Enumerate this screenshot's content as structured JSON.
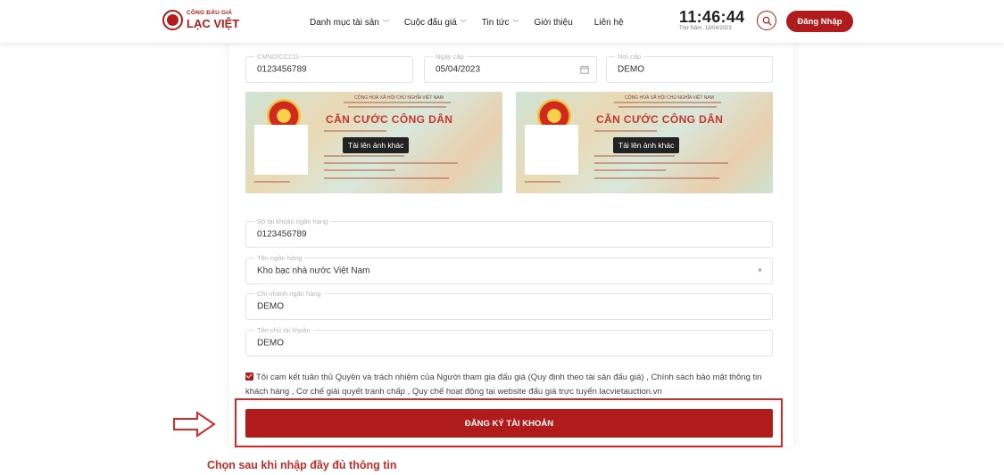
{
  "header": {
    "logo_top": "CÔNG ĐẤU GIÁ",
    "logo_name": "LẠC VIỆT",
    "nav": [
      "Danh mục tài sản",
      "Cuộc đấu giá",
      "Tin tức",
      "Giới thiệu",
      "Liên hệ"
    ],
    "time": "11:46:44",
    "date": "Thứ Năm, 13/04/2023",
    "login_label": "Đăng Nhập"
  },
  "form": {
    "id_number": {
      "label": "CMND/CCCD",
      "value": "0123456789"
    },
    "issue_date": {
      "label": "Ngày cấp",
      "value": "05/04/2023"
    },
    "issue_place": {
      "label": "Nơi cấp",
      "value": "DEMO"
    },
    "bank_account": {
      "label": "Số tài khoản ngân hàng",
      "value": "0123456789"
    },
    "bank_name": {
      "label": "Tên ngân hàng",
      "value": "Kho bạc nhà nước Việt Nam"
    },
    "bank_branch": {
      "label": "Chi nhánh ngân hàng",
      "value": "DEMO"
    },
    "account_holder": {
      "label": "Tên chủ tài khoản",
      "value": "DEMO"
    }
  },
  "id_cards": {
    "front": {
      "header": "CỘNG HOÀ XÃ HỘI CHỦ NGHĨA VIỆT NAM",
      "title": "CĂN CƯỚC CÔNG DÂN",
      "upload_label": "Tải lên ảnh khác"
    },
    "back": {
      "header": "CỘNG HOÀ XÃ HỘI CHỦ NGHĨA VIỆT NAM",
      "title": "CĂN CƯỚC CÔNG DÂN",
      "upload_label": "Tải lên ảnh khác"
    }
  },
  "terms": {
    "text": "Tôi cam kết tuân thủ Quyền và trách nhiệm của Người tham gia đấu giá (Quy định theo tài sản đấu giá) , Chính sách bảo mật thông tin khách hàng , Cơ chế giải quyết tranh chấp , Quy chế hoạt động tại website đấu giá trực tuyến lacvietauction.vn",
    "checked": true
  },
  "register_button": "ĐĂNG KÝ TÀI KHOẢN",
  "annotation": "Chọn sau khi nhập đầy đủ thông tin",
  "colors": {
    "brand": "#b01c1c",
    "highlight": "#d42a2a"
  },
  "icons": [
    "seal-logo-icon",
    "chevron-down-icon",
    "search-icon",
    "calendar-icon",
    "caret-down-icon",
    "check-icon",
    "arrow-right-icon"
  ]
}
